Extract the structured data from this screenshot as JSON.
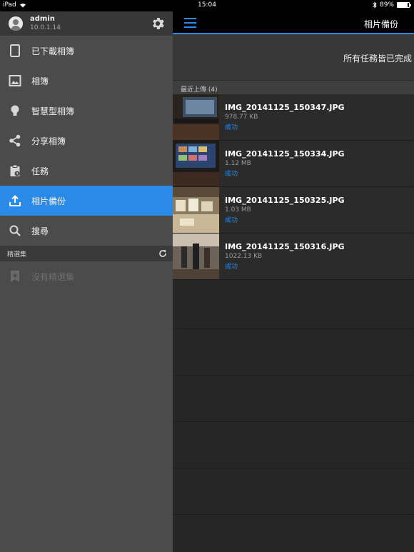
{
  "status_bar": {
    "device": "iPad",
    "time": "15:04",
    "battery": "89%",
    "battery_level": 0.89
  },
  "sidebar": {
    "account": {
      "name": "admin",
      "ip": "10.0.1.14"
    },
    "items": [
      {
        "label": "已下載相簿",
        "icon": "tablet-icon"
      },
      {
        "label": "相簿",
        "icon": "image-icon"
      },
      {
        "label": "智慧型相簿",
        "icon": "lightbulb-icon"
      },
      {
        "label": "分享相簿",
        "icon": "share-icon"
      },
      {
        "label": "任務",
        "icon": "clipboard-icon"
      },
      {
        "label": "相片備份",
        "icon": "upload-icon",
        "active": true
      },
      {
        "label": "搜尋",
        "icon": "search-icon"
      }
    ],
    "featured": {
      "header": "精選集",
      "empty_label": "沒有精選集"
    }
  },
  "main": {
    "title": "相片備份",
    "status_message": "所有任務皆已完成",
    "list_header": "最近上傳 (4)",
    "files": [
      {
        "name": "IMG_20141125_150347.JPG",
        "size": "978.77 KB",
        "status": "成功"
      },
      {
        "name": "IMG_20141125_150334.JPG",
        "size": "1.12 MB",
        "status": "成功"
      },
      {
        "name": "IMG_20141125_150325.JPG",
        "size": "1.03 MB",
        "status": "成功"
      },
      {
        "name": "IMG_20141125_150316.JPG",
        "size": "1022.13 KB",
        "status": "成功"
      }
    ]
  },
  "colors": {
    "accent": "#2a8ae8",
    "sidebar_bg": "#4b4b4b",
    "main_bg": "#262626"
  }
}
